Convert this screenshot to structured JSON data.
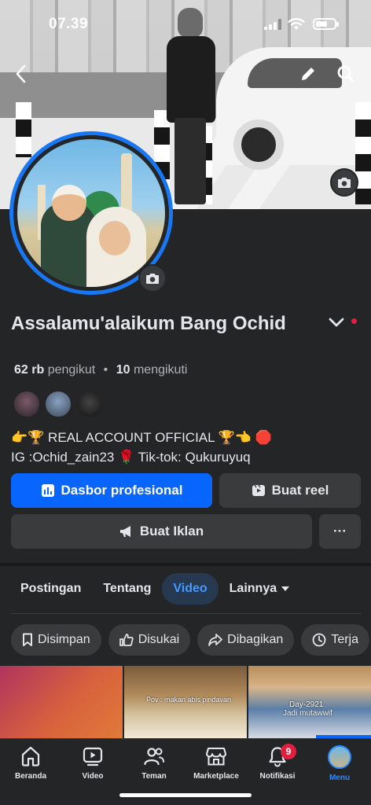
{
  "status_bar": {
    "time": "07.39"
  },
  "profile": {
    "name": "Assalamu'alaikum Bang Ochid",
    "followers_count": "62 rb",
    "followers_label": "pengikut",
    "separator": "•",
    "following_count": "10",
    "following_label": "mengikuti",
    "bio_line1": "👉🏆 REAL ACCOUNT OFFICIAL 🏆👈  🛑",
    "bio_line2": "IG :Ochid_zain23 🌹 Tik-tok: Qukuruyuq"
  },
  "actions": {
    "dashboard_label": "Dasbor profesional",
    "reel_label": "Buat reel",
    "ad_label": "Buat Iklan",
    "more_label": "···"
  },
  "tabs": [
    {
      "label": "Postingan",
      "active": false
    },
    {
      "label": "Tentang",
      "active": false
    },
    {
      "label": "Video",
      "active": true
    },
    {
      "label": "Lainnya",
      "active": false
    }
  ],
  "filters": [
    {
      "label": "Disimpan",
      "icon": "bookmark-icon"
    },
    {
      "label": "Disukai",
      "icon": "thumbs-up-icon"
    },
    {
      "label": "Dibagikan",
      "icon": "share-icon"
    },
    {
      "label": "Terja",
      "icon": "clock-icon"
    }
  ],
  "thumbnails": [
    {
      "caption": ""
    },
    {
      "caption": "Pov : makan abis pindavan"
    },
    {
      "caption": "Day-2921",
      "caption2": "Jadi mutawwif"
    }
  ],
  "bottom_nav": [
    {
      "label": "Beranda",
      "icon": "home-icon",
      "active": false
    },
    {
      "label": "Video",
      "icon": "video-icon",
      "active": false
    },
    {
      "label": "Teman",
      "icon": "friends-icon",
      "active": false
    },
    {
      "label": "Marketplace",
      "icon": "marketplace-icon",
      "active": false
    },
    {
      "label": "Notifikasi",
      "icon": "bell-icon",
      "active": false,
      "badge": "9"
    },
    {
      "label": "Menu",
      "icon": "menu-avatar",
      "active": true
    }
  ],
  "colors": {
    "background": "#242526",
    "accent": "#0866ff",
    "active_tab_bg": "#263951",
    "active_tab_text": "#4599ff",
    "badge": "#e41e3f"
  }
}
